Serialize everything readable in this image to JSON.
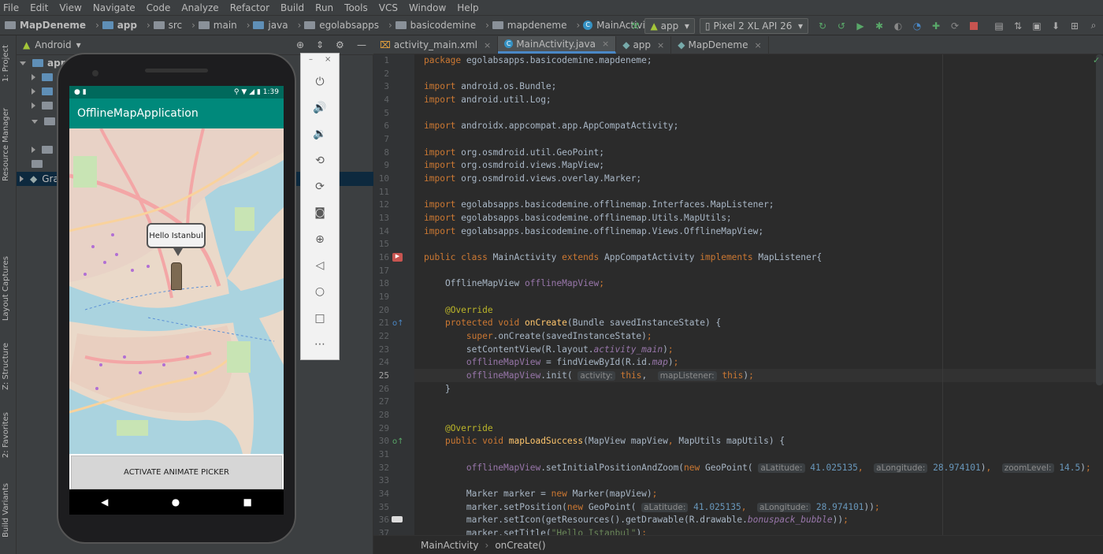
{
  "menu": [
    "File",
    "Edit",
    "View",
    "Navigate",
    "Code",
    "Analyze",
    "Refactor",
    "Build",
    "Run",
    "Tools",
    "VCS",
    "Window",
    "Help"
  ],
  "breadcrumbs": [
    "MapDeneme",
    "app",
    "src",
    "main",
    "java",
    "egolabsapps",
    "basicodemine",
    "mapdeneme",
    "MainActivity"
  ],
  "run_config": "app",
  "device": "Pixel 2 XL API 26",
  "left_strip": [
    "1: Project",
    "Resource Manager",
    "Layout Captures",
    "Z: Structure",
    "2: Favorites",
    "Build Variants"
  ],
  "project_view": "Android",
  "tree": [
    "app",
    "Gra"
  ],
  "phone": {
    "time": "1:39",
    "app_title": "OfflineMapApplication",
    "marker_bubble": "Hello Istanbul",
    "activate_button": "ACTIVATE ANIMATE PICKER"
  },
  "tabs": [
    {
      "label": "activity_main.xml",
      "active": false
    },
    {
      "label": "MainActivity.java",
      "active": true
    },
    {
      "label": "app",
      "active": false
    },
    {
      "label": "MapDeneme",
      "active": false
    }
  ],
  "code": {
    "line1": "egolabsapps.basicodemine.mapdeneme;",
    "imp3": "android.os.Bundle;",
    "imp4": "android.util.Log;",
    "imp6": "androidx.appcompat.app.AppCompatActivity;",
    "imp8": "org.osmdroid.util.GeoPoint;",
    "imp9": "org.osmdroid.views.MapView;",
    "imp10": "org.osmdroid.views.overlay.Marker;",
    "imp12": "egolabsapps.basicodemine.offlinemap.Interfaces.MapListener;",
    "imp13": "egolabsapps.basicodemine.offlinemap.Utils.MapUtils;",
    "imp14": "egolabsapps.basicodemine.offlinemap.Views.OfflineMapView;",
    "lat": "41.025135",
    "lon": "28.974101",
    "zoom": "14.5",
    "title_str": "\"Hello Istanbul\""
  },
  "breadcrumb_bottom": [
    "MainActivity",
    "onCreate()"
  ]
}
